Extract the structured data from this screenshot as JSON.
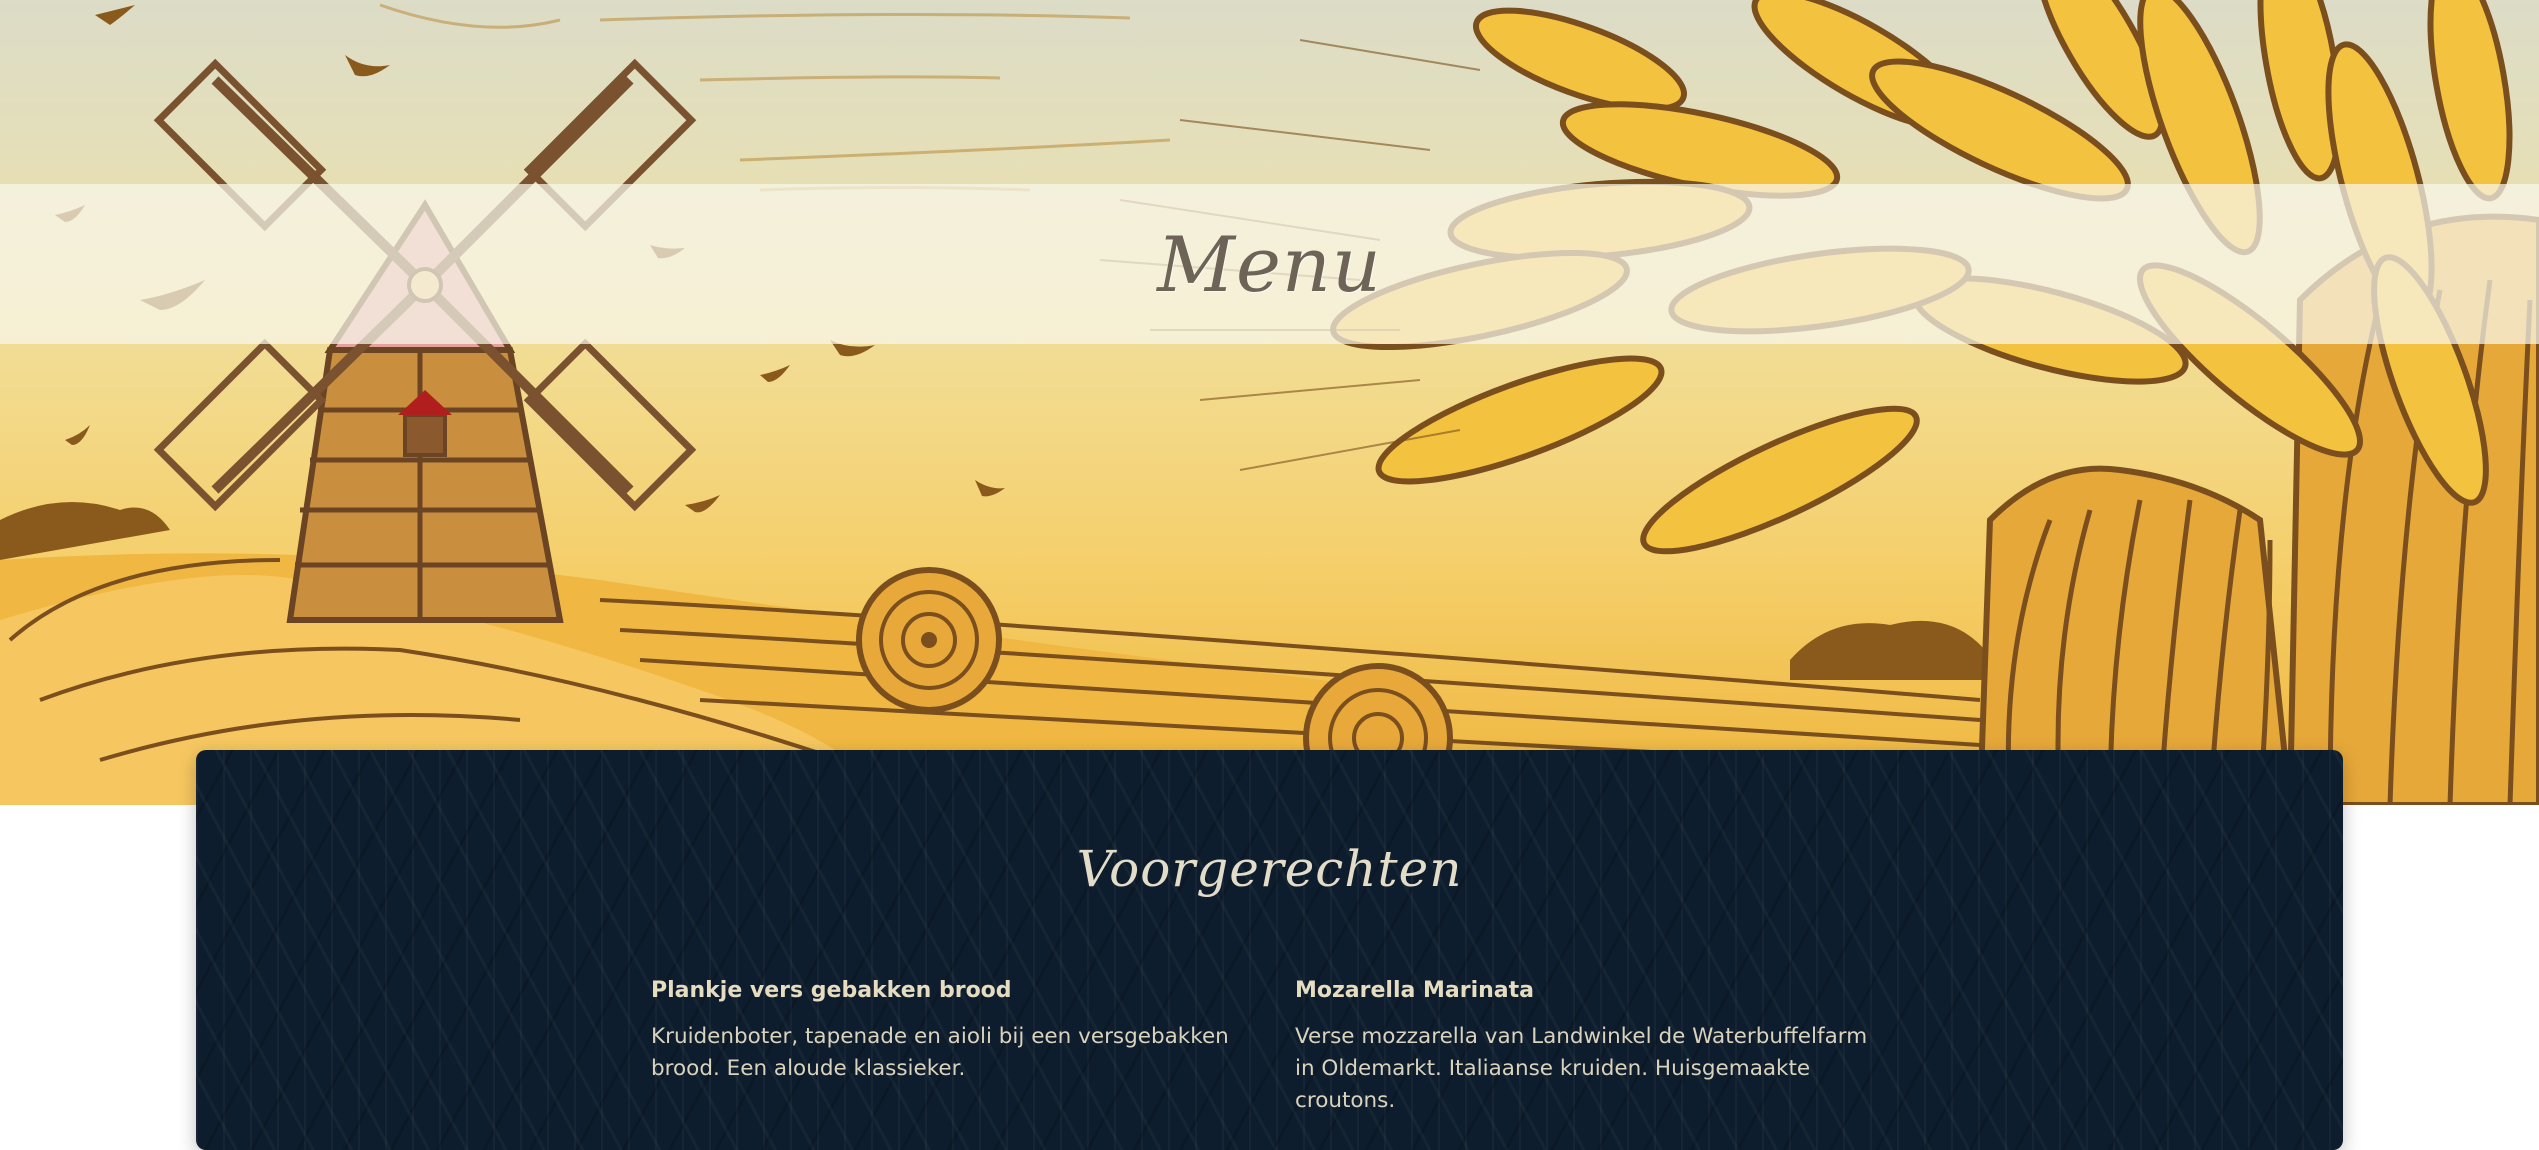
{
  "hero": {
    "menu_title": "Menu"
  },
  "section": {
    "title": "Voorgerechten"
  },
  "dishes": [
    {
      "name": "Plankje vers gebakken brood",
      "description": "Kruidenboter, tapenade en aioli bij een versgebakken brood. Een aloude klassieker."
    },
    {
      "name": "Mozarella Marinata",
      "description": "Verse mozzarella van Landwinkel de Waterbuffelfarm in Oldemarkt. Italiaanse kruiden. Huisgemaakte croutons."
    }
  ],
  "colors": {
    "card_background": "#0e1d2d",
    "hero_sky": "#dcdcc7",
    "hero_field": "#efb53b",
    "wheat_gold": "#f3c23f",
    "wheat_outline": "#7a4f1d",
    "windmill_brown": "#7a5230"
  },
  "icons": [
    "windmill-icon",
    "wheat-sheaf-icon",
    "hay-bale-icon",
    "bird-icon"
  ]
}
